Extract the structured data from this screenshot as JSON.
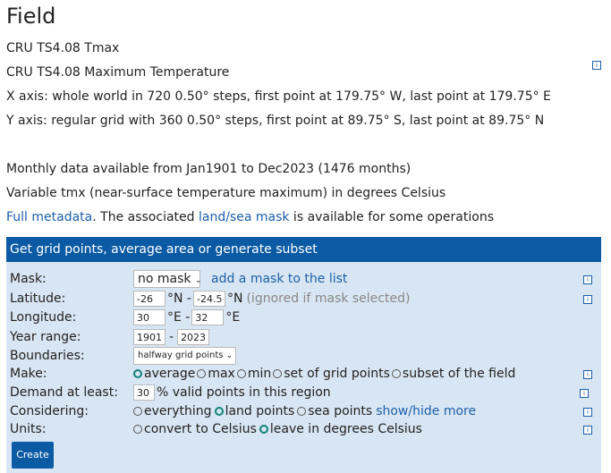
{
  "title": "Field",
  "field_name": "CRU TS4.08 Tmax",
  "field_long": "CRU TS4.08 Maximum Temperature",
  "x_axis": "X axis: whole world in 720 0.50° steps, first point at 179.75° W, last point at 179.75° E",
  "y_axis": "Y axis: regular grid with 360 0.50° steps, first point at 89.75° S, last point at 89.75° N",
  "availability": "Monthly data available from Jan1901 to Dec2023 (1476 months)",
  "variable": "Variable tmx (near-surface temperature maximum) in degrees Celsius",
  "metadata_link": "Full metadata",
  "metadata_mid": ". The associated ",
  "mask_link": "land/sea mask",
  "metadata_tail": " is available for some operations",
  "panel": {
    "header": "Get grid points, average area or generate subset",
    "mask_label": "Mask:",
    "mask_value": "no mask",
    "mask_add": "add a mask to the list",
    "lat_label": "Latitude:",
    "lat_from": "-26",
    "lat_unit1": "°N -",
    "lat_to": "-24.5",
    "lat_unit2": "°N",
    "lat_note": "(ignored if mask selected)",
    "lon_label": "Longitude:",
    "lon_from": "30",
    "lon_unit1": "°E -",
    "lon_to": "32",
    "lon_unit2": "°E",
    "year_label": "Year range:",
    "year_from": "1901",
    "year_sep": "-",
    "year_to": "2023",
    "bound_label": "Boundaries:",
    "bound_value": "halfway grid points",
    "make_label": "Make:",
    "make_options": [
      "average",
      "max",
      "min",
      "set of grid points",
      "subset of the field"
    ],
    "demand_label": "Demand at least:",
    "demand_value": "30",
    "demand_text": "% valid points in this region",
    "consider_label": "Considering:",
    "consider_options": [
      "everything",
      "land points",
      "sea points"
    ],
    "consider_more": "show/hide more",
    "units_label": "Units:",
    "units_options": [
      "convert to Celsius",
      "leave in degrees Celsius"
    ],
    "create_button": "Create"
  },
  "info_glyph": "i"
}
